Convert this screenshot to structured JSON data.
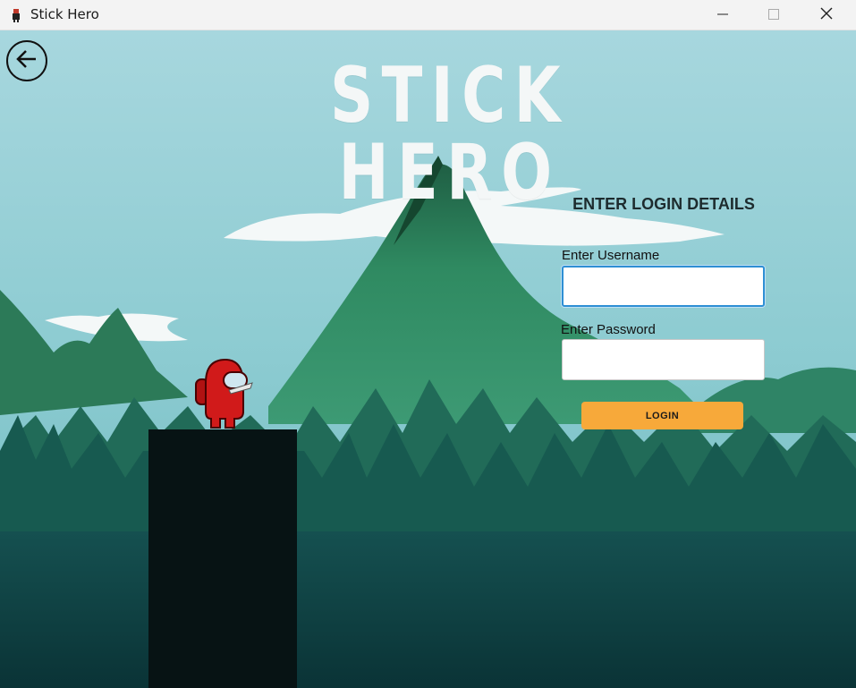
{
  "window": {
    "title": "Stick Hero",
    "minimize_icon": "minimize-icon",
    "maximize_icon": "maximize-icon",
    "close_icon": "close-icon"
  },
  "header": {
    "back_icon": "arrow-left-icon",
    "game_title": "STICK HERO"
  },
  "login": {
    "heading": "ENTER LOGIN DETAILS",
    "username_label": "Enter Username",
    "username_value": "",
    "password_label": "Enter Password",
    "password_value": "",
    "button_label": "LOGIN"
  },
  "colors": {
    "sky_top": "#a9d8df",
    "mountain": "#2f7d5c",
    "forest_dark": "#0f3c3c",
    "button": "#f7a93a",
    "hero": "#d11a1a",
    "pillar": "#071314"
  }
}
